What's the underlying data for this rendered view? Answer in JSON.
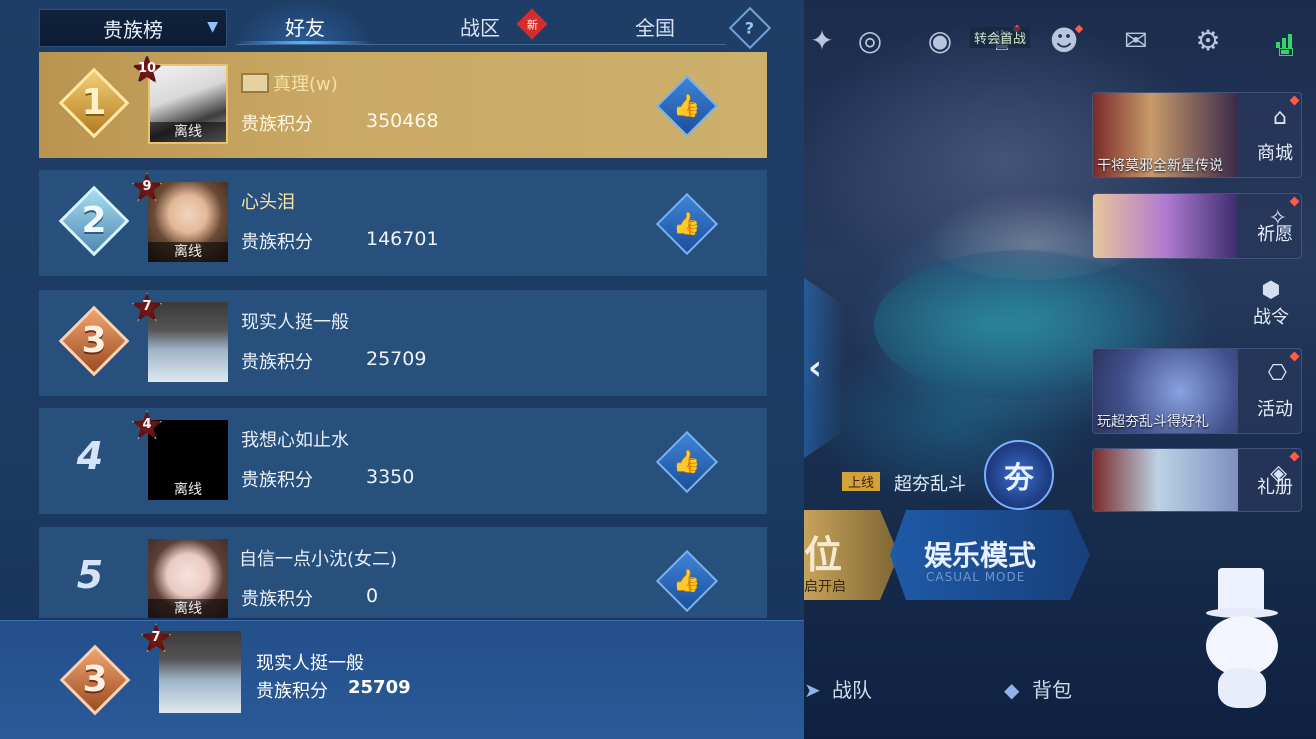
{
  "tabs": {
    "dropdown_label": "贵族榜",
    "friends": "好友",
    "zone": "战区",
    "zone_badge": "新",
    "national": "全国",
    "help": "?"
  },
  "leaderboard": [
    {
      "rank": "1",
      "level": "10",
      "name": "真理(w)",
      "score_label": "贵族积分",
      "score": "350468",
      "status": "离线"
    },
    {
      "rank": "2",
      "level": "9",
      "name": "心头泪",
      "score_label": "贵族积分",
      "score": "146701",
      "status": "离线"
    },
    {
      "rank": "3",
      "level": "7",
      "name": "现实人挺一般",
      "score_label": "贵族积分",
      "score": "25709",
      "status": ""
    },
    {
      "rank": "4",
      "level": "4",
      "name": "我想心如止水",
      "score_label": "贵族积分",
      "score": "3350",
      "status": "离线"
    },
    {
      "rank": "5",
      "level": "",
      "name": "自信一点小沈(女二)",
      "score_label": "贵族积分",
      "score": "0",
      "status": "离线"
    }
  ],
  "my_rank": {
    "rank": "3",
    "level": "7",
    "name": "现实人挺一般",
    "score_label": "贵族积分",
    "score": "25709"
  },
  "scene": {
    "top_tag": "转会首战",
    "promos": [
      {
        "caption": "干将莫邪全新星传说",
        "label": "商城"
      },
      {
        "caption": "",
        "label": "祈愿"
      },
      {
        "caption": "玩超夯乱斗得好礼",
        "label": "活动"
      },
      {
        "caption": "",
        "label": "礼册"
      }
    ],
    "battle_pass": "战令",
    "mode_tag": "上线",
    "mode_name": "超夯乱斗",
    "mode_emblem": "夯",
    "ranked_title": "位",
    "ranked_sub": "启开启",
    "casual_title": "娱乐模式",
    "casual_sub": "CASUAL MODE",
    "bottom_team": "战队",
    "bottom_bag": "背包"
  },
  "colors": {
    "panel_bg": "#1f3e67",
    "row_bg": "#28507c",
    "gold_row": "#c9a964",
    "accent": "#58b4ff",
    "red_badge": "#d52c2c"
  }
}
